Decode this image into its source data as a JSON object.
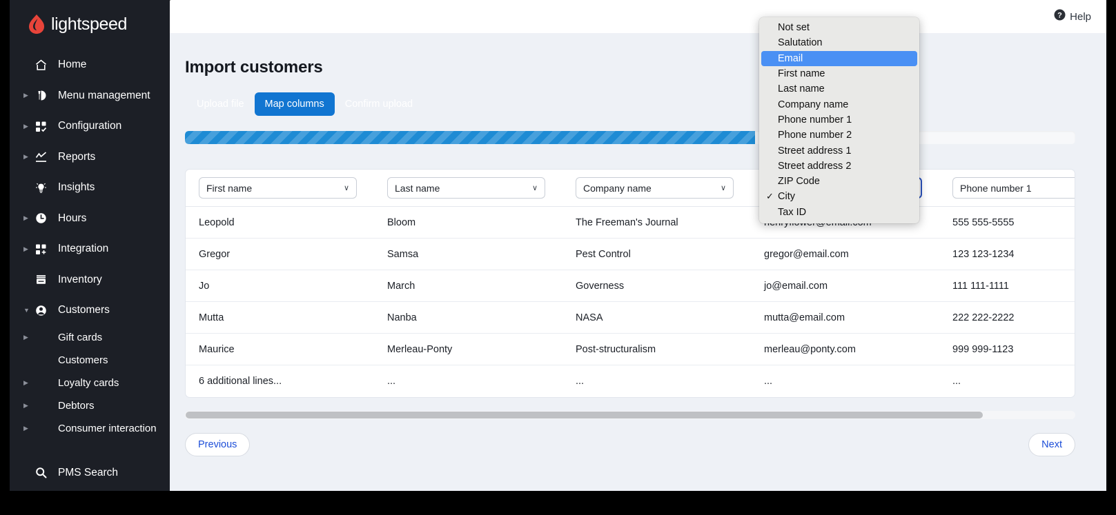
{
  "sidebar": {
    "brand": "lightspeed",
    "items": [
      {
        "label": "Home",
        "icon": "home-icon",
        "caret": false,
        "sub": false
      },
      {
        "label": "Menu management",
        "icon": "menu-management-icon",
        "caret": true,
        "sub": false
      },
      {
        "label": "Configuration",
        "icon": "configuration-icon",
        "caret": true,
        "sub": false
      },
      {
        "label": "Reports",
        "icon": "reports-icon",
        "caret": true,
        "sub": false
      },
      {
        "label": "Insights",
        "icon": "insights-icon",
        "caret": false,
        "sub": false
      },
      {
        "label": "Hours",
        "icon": "hours-icon",
        "caret": true,
        "sub": false
      },
      {
        "label": "Integration",
        "icon": "integration-icon",
        "caret": true,
        "sub": false
      },
      {
        "label": "Inventory",
        "icon": "inventory-icon",
        "caret": false,
        "sub": false
      },
      {
        "label": "Customers",
        "icon": "customers-icon",
        "caret": true,
        "caret_open": true,
        "sub": false
      },
      {
        "label": "Gift cards",
        "icon": "",
        "caret": true,
        "sub": true
      },
      {
        "label": "Customers",
        "icon": "",
        "caret": false,
        "sub": true
      },
      {
        "label": "Loyalty cards",
        "icon": "",
        "caret": true,
        "sub": true
      },
      {
        "label": "Debtors",
        "icon": "",
        "caret": true,
        "sub": true
      },
      {
        "label": "Consumer interaction",
        "icon": "",
        "caret": true,
        "sub": true
      },
      {
        "label": "PMS Search",
        "icon": "search-icon",
        "caret": false,
        "sub": false,
        "spaced": true
      }
    ]
  },
  "topbar": {
    "help_label": "Help",
    "help_icon": "help-circle-icon"
  },
  "page": {
    "title": "Import customers",
    "steps": [
      {
        "label": "Upload file",
        "active": false
      },
      {
        "label": "Map columns",
        "active": true
      },
      {
        "label": "Confirm upload",
        "active": false
      }
    ],
    "progress_percent": 64
  },
  "table": {
    "headers": [
      {
        "value": "First name",
        "focused": false
      },
      {
        "value": "Last name",
        "focused": false
      },
      {
        "value": "Company name",
        "focused": false
      },
      {
        "value": "City",
        "focused": true
      },
      {
        "value": "Phone number 1",
        "focused": false
      }
    ],
    "rows": [
      [
        "Leopold",
        "Bloom",
        "The Freeman's Journal",
        "henryflower@email.com",
        "555 555-5555"
      ],
      [
        "Gregor",
        "Samsa",
        "Pest Control",
        "gregor@email.com",
        "123 123-1234"
      ],
      [
        "Jo",
        "March",
        "Governess",
        "jo@email.com",
        "111 111-1111"
      ],
      [
        "Mutta",
        "Nanba",
        "NASA",
        "mutta@email.com",
        "222 222-2222"
      ],
      [
        "Maurice",
        "Merleau-Ponty",
        "Post-structuralism",
        "merleau@ponty.com",
        "999 999-1123"
      ],
      [
        "6 additional lines...",
        "...",
        "...",
        "...",
        "..."
      ]
    ]
  },
  "footer": {
    "previous_label": "Previous",
    "next_label": "Next"
  },
  "dropdown": {
    "options": [
      {
        "label": "Not set",
        "checked": false,
        "highlighted": false
      },
      {
        "label": "Salutation",
        "checked": false,
        "highlighted": false
      },
      {
        "label": "Email",
        "checked": false,
        "highlighted": true
      },
      {
        "label": "First name",
        "checked": false,
        "highlighted": false
      },
      {
        "label": "Last name",
        "checked": false,
        "highlighted": false
      },
      {
        "label": "Company name",
        "checked": false,
        "highlighted": false
      },
      {
        "label": "Phone number 1",
        "checked": false,
        "highlighted": false
      },
      {
        "label": "Phone number 2",
        "checked": false,
        "highlighted": false
      },
      {
        "label": "Street address 1",
        "checked": false,
        "highlighted": false
      },
      {
        "label": "Street address 2",
        "checked": false,
        "highlighted": false
      },
      {
        "label": "ZIP Code",
        "checked": false,
        "highlighted": false
      },
      {
        "label": "City",
        "checked": true,
        "highlighted": false
      },
      {
        "label": "Tax ID",
        "checked": false,
        "highlighted": false
      }
    ],
    "check_glyph": "✓"
  },
  "colors": {
    "accent": "#1175d1",
    "sidebar_bg": "#1c1f26",
    "brand_red": "#e8443a",
    "highlight_blue": "#4a90f4",
    "link_blue": "#1d4ed8"
  }
}
